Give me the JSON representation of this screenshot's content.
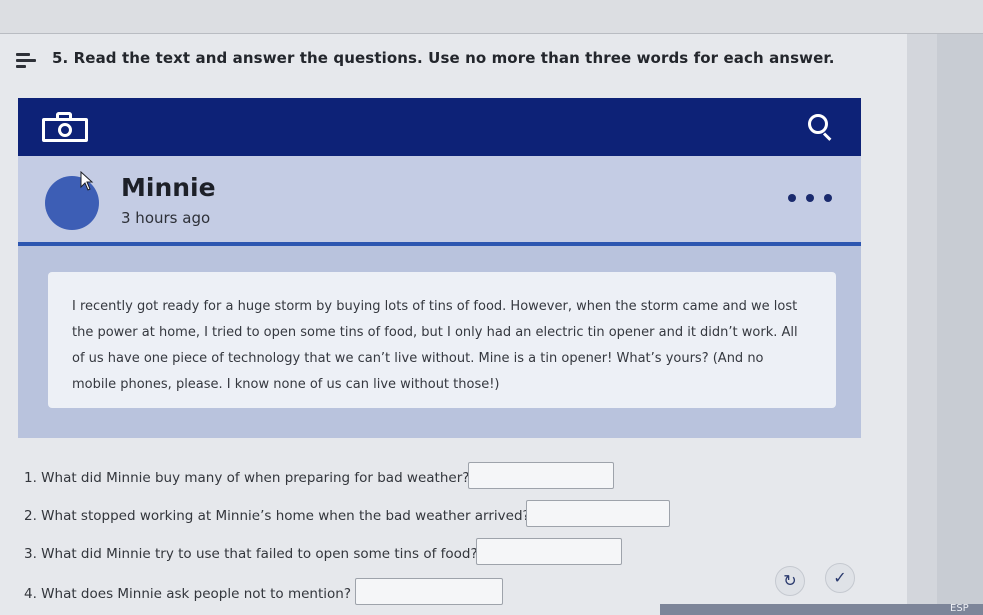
{
  "instruction": {
    "text": "5. Read the text and answer the questions. Use no more than three words for each answer.",
    "icon": "list-icon"
  },
  "post": {
    "header_icons": [
      "camera-icon",
      "search-icon"
    ],
    "author": "Minnie",
    "time": "3 hours ago",
    "more_icon": "more-dots-icon",
    "body_lines": [
      "I recently got ready for a huge storm by buying lots of tins of food. However, when the storm came and we lost",
      "the power at home, I tried to open some tins of food, but I only had an electric tin opener and it didn’t work. All",
      "of us have one piece of technology that we can’t live without. Mine is a tin opener! What’s yours? (And no",
      "mobile phones, please. I know none of us can live without those!)"
    ],
    "colors": {
      "header": "#0d2277",
      "avatar": "#3d5eb5",
      "divider": "#2d56b0"
    }
  },
  "questions": [
    {
      "text": "1. What did Minnie buy many of when preparing for bad weather?",
      "answer": ""
    },
    {
      "text": "2. What stopped working at Minnie’s home when the bad weather arrived?",
      "answer": ""
    },
    {
      "text": "3. What did Minnie try to use that failed to open some tins of food?",
      "answer": ""
    },
    {
      "text": "4. What does Minnie ask people not to mention?",
      "answer": ""
    }
  ],
  "controls": {
    "retry_glyph": "↻",
    "check_glyph": "✓"
  },
  "footer": {
    "language": "ESP"
  }
}
